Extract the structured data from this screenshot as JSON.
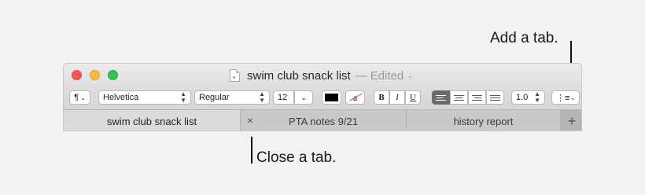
{
  "callouts": {
    "add_tab": "Add a tab.",
    "close_tab": "Close a tab."
  },
  "window": {
    "title": "swim club snack list",
    "separator": "—",
    "status": "Edited"
  },
  "toolbar": {
    "paragraph_icon": "¶",
    "font_family": "Helvetica",
    "font_style": "Regular",
    "font_size": "12",
    "text_color": "#000000",
    "highlight_glyph": "a",
    "bold": "B",
    "italic": "I",
    "underline": "U",
    "line_spacing": "1.0"
  },
  "tabs": [
    {
      "label": "swim club snack list",
      "active": true
    },
    {
      "label": "PTA notes 9/21",
      "active": false
    },
    {
      "label": "history report",
      "active": false
    }
  ],
  "icons": {
    "close_tab": "×",
    "add_tab": "+"
  }
}
